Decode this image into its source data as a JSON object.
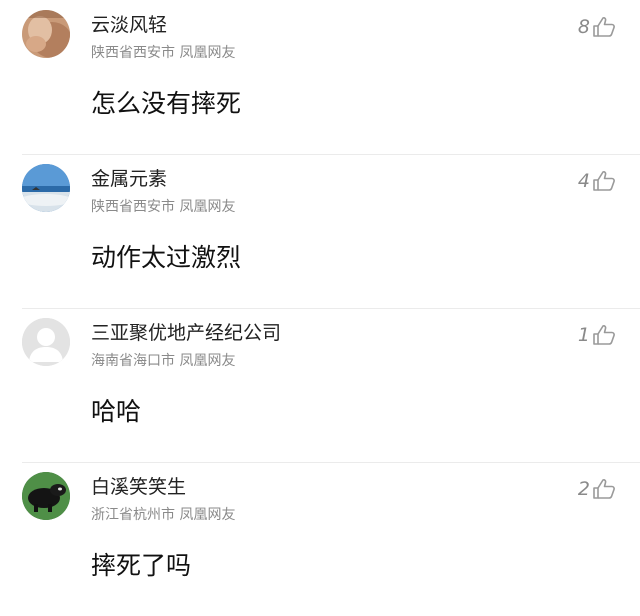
{
  "comments": [
    {
      "username": "云淡风轻",
      "location": "陕西省西安市 凤凰网友",
      "text": "怎么没有摔死",
      "likes": "8",
      "avatar_icon": "portrait-photo-icon"
    },
    {
      "username": "金属元素",
      "location": "陕西省西安市 凤凰网友",
      "text": "动作太过激烈",
      "likes": "4",
      "avatar_icon": "beach-photo-icon"
    },
    {
      "username": "三亚聚优地产经纪公司",
      "location": "海南省海口市 凤凰网友",
      "text": "哈哈",
      "likes": "1",
      "avatar_icon": "default-user-icon"
    },
    {
      "username": "白溪笑笑生",
      "location": "浙江省杭州市 凤凰网友",
      "text": "摔死了吗",
      "likes": "2",
      "avatar_icon": "animal-photo-icon"
    }
  ],
  "like_icon": "thumbs-up-icon",
  "colors": {
    "background": "#ffffff",
    "username": "#222222",
    "meta": "#8a8a8a",
    "divider": "#ebebeb"
  }
}
